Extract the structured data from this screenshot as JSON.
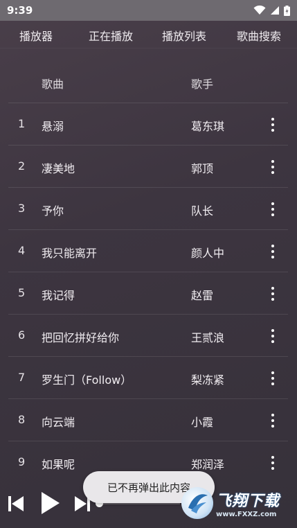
{
  "status": {
    "time": "9:39"
  },
  "tabs": [
    {
      "label": "播放器"
    },
    {
      "label": "正在播放"
    },
    {
      "label": "播放列表"
    },
    {
      "label": "歌曲搜索"
    }
  ],
  "header": {
    "title_col": "歌曲",
    "artist_col": "歌手"
  },
  "songs": [
    {
      "num": "1",
      "title": "悬溺",
      "artist": "葛东琪"
    },
    {
      "num": "2",
      "title": "凄美地",
      "artist": "郭顶"
    },
    {
      "num": "3",
      "title": "予你",
      "artist": "队长"
    },
    {
      "num": "4",
      "title": "我只能离开",
      "artist": "颜人中"
    },
    {
      "num": "5",
      "title": "我记得",
      "artist": "赵雷"
    },
    {
      "num": "6",
      "title": "把回忆拼好给你",
      "artist": "王贰浪"
    },
    {
      "num": "7",
      "title": "罗生门（Follow）",
      "artist": "梨冻紧"
    },
    {
      "num": "8",
      "title": "向云端",
      "artist": "小霞"
    },
    {
      "num": "9",
      "title": "如果呢",
      "artist": "郑润泽"
    }
  ],
  "toast": "已不再弹出此内容",
  "watermark": {
    "brand": "飞翔下载",
    "url": "www.FXXZ.com"
  },
  "player": {
    "progress": 0.0
  }
}
